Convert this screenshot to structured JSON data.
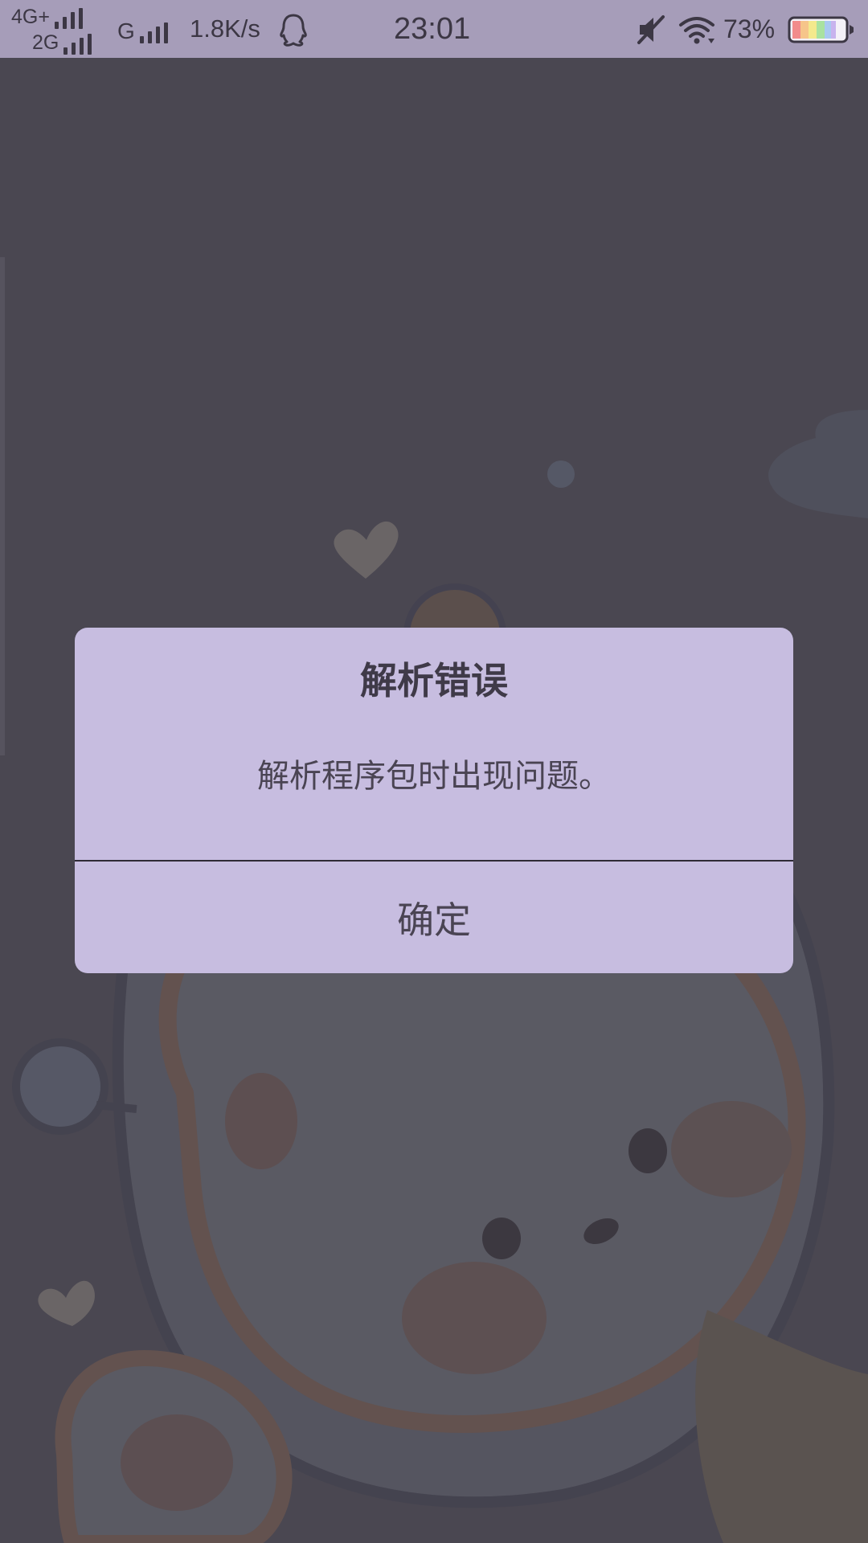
{
  "status_bar": {
    "network_primary": "4G+",
    "network_secondary": "2G",
    "network_tertiary": "G",
    "speed": "1.8K/s",
    "time": "23:01",
    "battery_percent": "73%",
    "icons": [
      "signal-bars-icon",
      "qq-icon",
      "mute-icon",
      "wifi-icon",
      "battery-icon"
    ],
    "bar_color": "#a69db9"
  },
  "dialog": {
    "title": "解析错误",
    "message": "解析程序包时出现问题。",
    "ok_label": "确定",
    "background_color": "#c7bde0"
  },
  "background": {
    "color": "#4a4751",
    "wallpaper": "cartoon-bear-illustration"
  }
}
